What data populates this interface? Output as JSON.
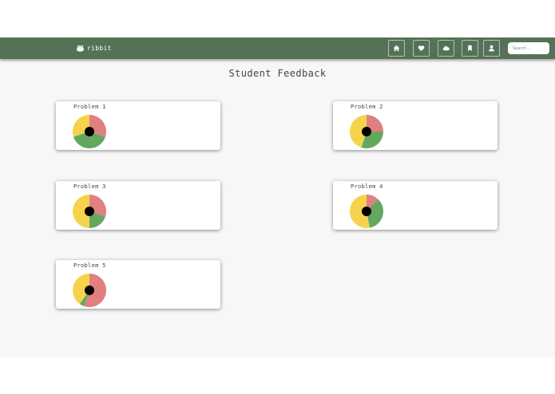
{
  "app": {
    "name": "ribbit"
  },
  "nav": {
    "buttons": [
      {
        "icon": "home-icon"
      },
      {
        "icon": "heart-icon"
      },
      {
        "icon": "cloud-icon"
      },
      {
        "icon": "bookmark-icon"
      },
      {
        "icon": "user-icon"
      }
    ],
    "search_placeholder": "Search..."
  },
  "page": {
    "title": "Student Feedback"
  },
  "colors": {
    "navbar": "#577559",
    "red": "#e08080",
    "green": "#64a860",
    "yellow": "#f6d34d",
    "center": "#000000"
  },
  "problems": [
    {
      "label": "Problem 1",
      "feedback": {
        "red": 0.3,
        "green": 0.4,
        "yellow": 0.3
      }
    },
    {
      "label": "Problem 2",
      "feedback": {
        "red": 0.25,
        "green": 0.3,
        "yellow": 0.45
      }
    },
    {
      "label": "Problem 3",
      "feedback": {
        "red": 0.3,
        "green": 0.2,
        "yellow": 0.5
      }
    },
    {
      "label": "Problem 4",
      "feedback": {
        "red": 0.12,
        "green": 0.35,
        "yellow": 0.53
      }
    },
    {
      "label": "Problem 5",
      "feedback": {
        "red": 0.55,
        "green": 0.05,
        "yellow": 0.4
      }
    }
  ]
}
